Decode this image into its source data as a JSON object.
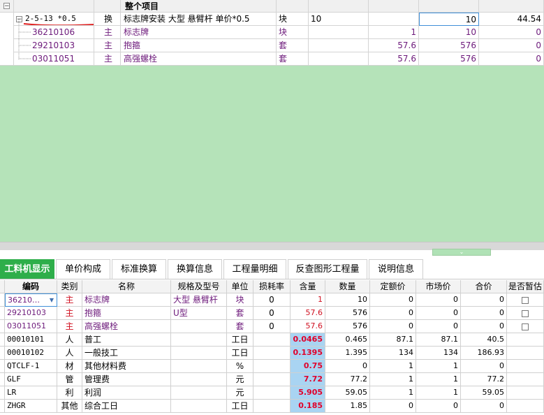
{
  "top_grid": {
    "header": {
      "title": "整个项目",
      "collapse": "−"
    },
    "main_row": {
      "code": "2-5-13 *0.5",
      "type": "换",
      "name": "标志牌安装 大型 悬臂杆  单价*0.5",
      "unit": "块",
      "qty_expr": "10",
      "qty": "10",
      "price": "44.54"
    },
    "sub_rows": [
      {
        "code": "36210106",
        "type": "主",
        "name": "标志牌",
        "unit": "块",
        "content": "1",
        "qty": "10",
        "price": "0"
      },
      {
        "code": "29210103",
        "type": "主",
        "name": "抱箍",
        "unit": "套",
        "content": "57.6",
        "qty": "576",
        "price": "0"
      },
      {
        "code": "03011051",
        "type": "主",
        "name": "高强螺栓",
        "unit": "套",
        "content": "57.6",
        "qty": "576",
        "price": "0"
      }
    ]
  },
  "tabs": [
    {
      "label": "工料机显示",
      "active": true
    },
    {
      "label": "单价构成"
    },
    {
      "label": "标准换算"
    },
    {
      "label": "换算信息"
    },
    {
      "label": "工程量明细"
    },
    {
      "label": "反查图形工程量"
    },
    {
      "label": "说明信息"
    }
  ],
  "lower_grid": {
    "columns": [
      "编码",
      "类别",
      "名称",
      "规格及型号",
      "单位",
      "损耗率",
      "含量",
      "数量",
      "定额价",
      "市场价",
      "合价",
      "是否暂估"
    ],
    "rows": [
      {
        "code": "36210…",
        "cat": "主",
        "name": "标志牌",
        "spec": "大型 悬臂杆",
        "unit": "块",
        "loss": "0",
        "content": "1",
        "qty": "10",
        "base": "0",
        "market": "0",
        "total": "0",
        "est": true,
        "purple": true,
        "dropdown": true
      },
      {
        "code": "29210103",
        "cat": "主",
        "name": "抱箍",
        "spec": "U型",
        "unit": "套",
        "loss": "0",
        "content": "57.6",
        "qty": "576",
        "base": "0",
        "market": "0",
        "total": "0",
        "est": true,
        "purple": true
      },
      {
        "code": "03011051",
        "cat": "主",
        "name": "高强螺栓",
        "spec": "",
        "unit": "套",
        "loss": "0",
        "content": "57.6",
        "qty": "576",
        "base": "0",
        "market": "0",
        "total": "0",
        "est": true,
        "purple": true
      },
      {
        "code": "00010101",
        "cat": "人",
        "name": "普工",
        "spec": "",
        "unit": "工日",
        "loss": "",
        "content": "0.0465",
        "qty": "0.465",
        "base": "87.1",
        "market": "87.1",
        "total": "40.5",
        "hl": true
      },
      {
        "code": "00010102",
        "cat": "人",
        "name": "一般技工",
        "spec": "",
        "unit": "工日",
        "loss": "",
        "content": "0.1395",
        "qty": "1.395",
        "base": "134",
        "market": "134",
        "total": "186.93",
        "hl": true
      },
      {
        "code": "QTCLF-1",
        "cat": "材",
        "name": "其他材料费",
        "spec": "",
        "unit": "%",
        "loss": "",
        "content": "0.75",
        "qty": "0",
        "base": "1",
        "market": "1",
        "total": "0",
        "hl": true
      },
      {
        "code": "GLF",
        "cat": "管",
        "name": "管理费",
        "spec": "",
        "unit": "元",
        "loss": "",
        "content": "7.72",
        "qty": "77.2",
        "base": "1",
        "market": "1",
        "total": "77.2",
        "hl": true
      },
      {
        "code": "LR",
        "cat": "利",
        "name": "利润",
        "spec": "",
        "unit": "元",
        "loss": "",
        "content": "5.905",
        "qty": "59.05",
        "base": "1",
        "market": "1",
        "total": "59.05",
        "hl": true
      },
      {
        "code": "ZHGR",
        "cat": "其他",
        "name": "综合工日",
        "spec": "",
        "unit": "工日",
        "loss": "",
        "content": "0.185",
        "qty": "1.85",
        "base": "0",
        "market": "0",
        "total": "0",
        "hl": true
      }
    ]
  },
  "colors": {
    "green_bg": "#b5e3b9",
    "tab_active": "#2eae4a",
    "highlight": "#a9d4f2",
    "purple_text": "#6d1a7b"
  }
}
